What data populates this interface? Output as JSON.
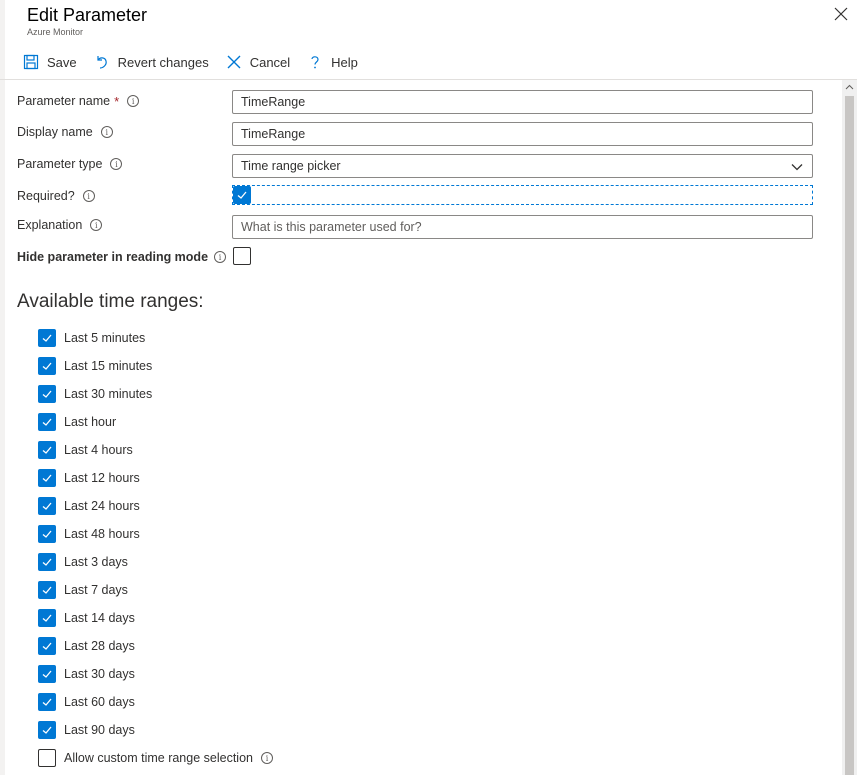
{
  "header": {
    "title": "Edit Parameter",
    "subtitle": "Azure Monitor"
  },
  "toolbar": {
    "save": "Save",
    "revert": "Revert changes",
    "cancel": "Cancel",
    "help": "Help"
  },
  "form": {
    "parameter_name": {
      "label": "Parameter name",
      "required_mark": "*",
      "value": "TimeRange"
    },
    "display_name": {
      "label": "Display name",
      "value": "TimeRange"
    },
    "parameter_type": {
      "label": "Parameter type",
      "value": "Time range picker"
    },
    "required": {
      "label": "Required?",
      "checked": true
    },
    "explanation": {
      "label": "Explanation",
      "placeholder": "What is this parameter used for?"
    },
    "hide_param": {
      "label": "Hide parameter in reading mode",
      "checked": false
    }
  },
  "time_ranges": {
    "title": "Available time ranges:",
    "items": [
      {
        "label": "Last 5 minutes",
        "checked": true
      },
      {
        "label": "Last 15 minutes",
        "checked": true
      },
      {
        "label": "Last 30 minutes",
        "checked": true
      },
      {
        "label": "Last hour",
        "checked": true
      },
      {
        "label": "Last 4 hours",
        "checked": true
      },
      {
        "label": "Last 12 hours",
        "checked": true
      },
      {
        "label": "Last 24 hours",
        "checked": true
      },
      {
        "label": "Last 48 hours",
        "checked": true
      },
      {
        "label": "Last 3 days",
        "checked": true
      },
      {
        "label": "Last 7 days",
        "checked": true
      },
      {
        "label": "Last 14 days",
        "checked": true
      },
      {
        "label": "Last 28 days",
        "checked": true
      },
      {
        "label": "Last 30 days",
        "checked": true
      },
      {
        "label": "Last 60 days",
        "checked": true
      },
      {
        "label": "Last 90 days",
        "checked": true
      }
    ],
    "custom": {
      "label": "Allow custom time range selection",
      "checked": false
    }
  },
  "colors": {
    "accent": "#0078d4",
    "text": "#323130",
    "border": "#8a8886",
    "required": "#a4262c"
  },
  "icons": {
    "save": "save-icon",
    "revert": "revert-icon",
    "cancel": "cancel-icon",
    "help": "help-icon",
    "close": "close-icon",
    "info": "info-icon",
    "check": "check-icon",
    "chevron": "chevron-down-icon"
  }
}
